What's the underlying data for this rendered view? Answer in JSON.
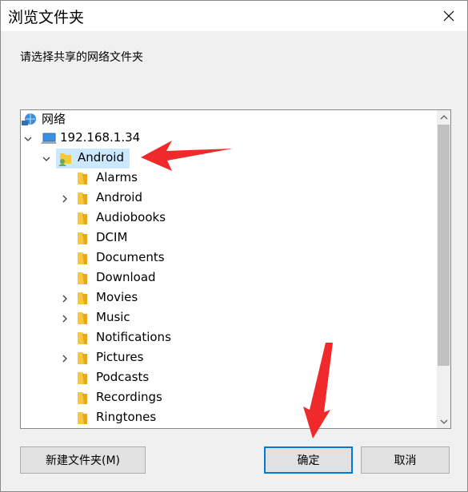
{
  "window": {
    "title": "浏览文件夹"
  },
  "prompt": "请选择共享的网络文件夹",
  "tree": {
    "network_label": "网络",
    "host_label": "192.168.1.34",
    "share_label": "Android",
    "folders": [
      {
        "label": "Alarms",
        "expandable": false
      },
      {
        "label": "Android",
        "expandable": true
      },
      {
        "label": "Audiobooks",
        "expandable": false
      },
      {
        "label": "DCIM",
        "expandable": false
      },
      {
        "label": "Documents",
        "expandable": false
      },
      {
        "label": "Download",
        "expandable": false
      },
      {
        "label": "Movies",
        "expandable": true
      },
      {
        "label": "Music",
        "expandable": true
      },
      {
        "label": "Notifications",
        "expandable": false
      },
      {
        "label": "Pictures",
        "expandable": true
      },
      {
        "label": "Podcasts",
        "expandable": false
      },
      {
        "label": "Recordings",
        "expandable": false
      },
      {
        "label": "Ringtones",
        "expandable": false
      }
    ]
  },
  "buttons": {
    "new_folder": "新建文件夹(M)",
    "ok": "确定",
    "cancel": "取消"
  },
  "colors": {
    "selection": "#cce8ff",
    "folder": "#f8c83c",
    "accent": "#0078d7",
    "arrow": "#f02a2a"
  }
}
